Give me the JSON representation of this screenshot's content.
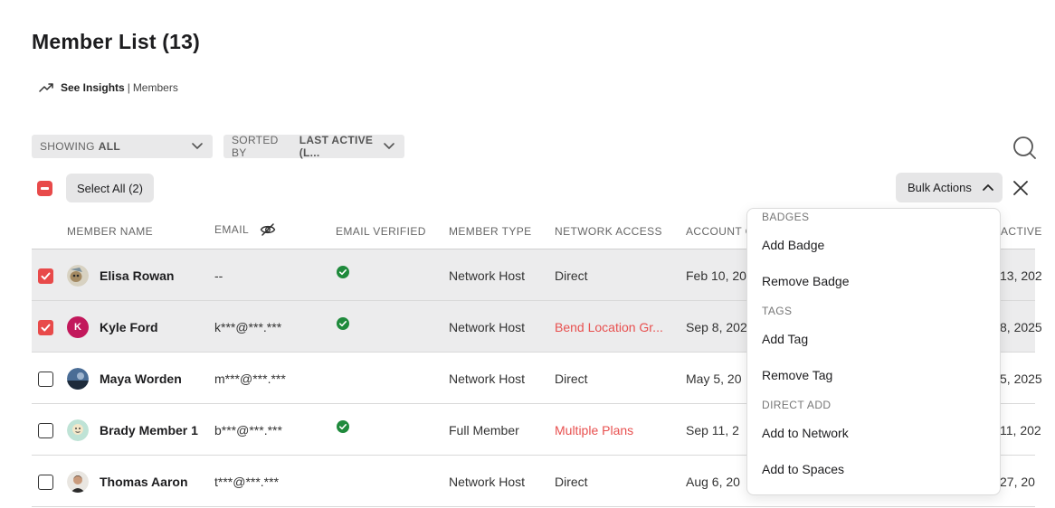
{
  "page": {
    "title": "Member List (13)",
    "insights_link": "See Insights",
    "insights_sep": "|",
    "insights_sub": "Members"
  },
  "filters": {
    "showing_prefix": "SHOWING",
    "showing_value": "ALL",
    "sorted_prefix": "SORTED BY",
    "sorted_value": "LAST ACTIVE (L..."
  },
  "toolbar": {
    "select_all_label": "Select All (2)",
    "bulk_actions_label": "Bulk Actions"
  },
  "table": {
    "columns": [
      "MEMBER NAME",
      "EMAIL",
      "EMAIL VERIFIED",
      "MEMBER TYPE",
      "NETWORK ACCESS",
      "ACCOUNT C",
      "ACTIVE"
    ],
    "rows": [
      {
        "selected": true,
        "name": "Elisa Rowan",
        "email": "--",
        "verified": true,
        "type": "Network Host",
        "access": "Direct",
        "access_highlight": false,
        "account": "Feb 10, 20",
        "active": "13, 202"
      },
      {
        "selected": true,
        "name": "Kyle Ford",
        "email": "k***@***.***",
        "verified": true,
        "type": "Network Host",
        "access": "Bend Location Gr...",
        "access_highlight": true,
        "account": "Sep 8, 202",
        "active": "8, 2025",
        "avatar_letter": "K"
      },
      {
        "selected": false,
        "name": "Maya Worden",
        "email": "m***@***.***",
        "verified": false,
        "type": "Network Host",
        "access": "Direct",
        "access_highlight": false,
        "account": "May 5, 20",
        "active": "5, 2025"
      },
      {
        "selected": false,
        "name": "Brady Member 1",
        "email": "b***@***.***",
        "verified": true,
        "type": "Full Member",
        "access": "Multiple Plans",
        "access_highlight": true,
        "account": "Sep 11, 2",
        "active": "11, 202"
      },
      {
        "selected": false,
        "name": "Thomas Aaron",
        "email": "t***@***.***",
        "verified": false,
        "type": "Network Host",
        "access": "Direct",
        "access_highlight": false,
        "account": "Aug 6, 20",
        "active": "27, 20"
      }
    ]
  },
  "bulk_menu": {
    "sections": [
      {
        "title": "BADGES",
        "items": [
          "Add Badge",
          "Remove Badge"
        ]
      },
      {
        "title": "TAGS",
        "items": [
          "Add Tag",
          "Remove Tag"
        ]
      },
      {
        "title": "DIRECT ADD",
        "items": [
          "Add to Network",
          "Add to Spaces"
        ]
      }
    ]
  },
  "icons": {
    "insights": "trend-up-icon",
    "search": "search-icon",
    "close": "close-icon",
    "hide_email": "eye-off-icon",
    "verified": "check-circle-icon"
  },
  "colors": {
    "accent_red": "#e84a4a",
    "link_red": "#e8504f",
    "verified_green": "#1f8a3c",
    "selected_row_bg": "#ececed",
    "kyle_avatar_bg": "#c2185b"
  }
}
